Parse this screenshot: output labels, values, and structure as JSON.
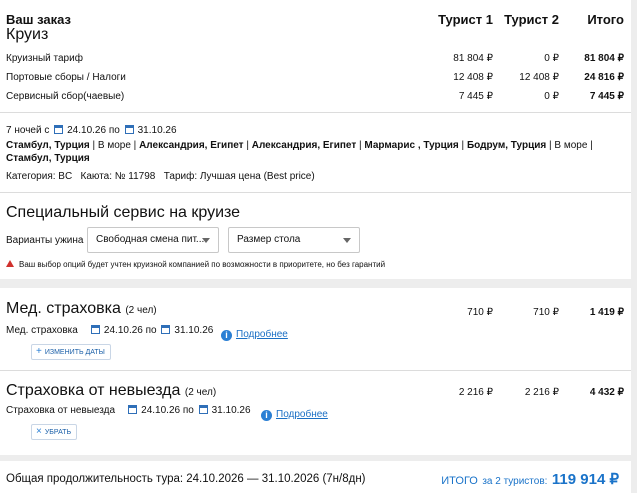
{
  "order": {
    "title": "Ваш заказ",
    "subtitle": "Круиз",
    "col_t1": "Турист 1",
    "col_t2": "Турист 2",
    "col_total": "Итого",
    "rows": [
      {
        "label": "Круизный тариф",
        "t1": "81 804 ₽",
        "t2": "0 ₽",
        "total": "81 804 ₽"
      },
      {
        "label": "Портовые сборы / Налоги",
        "t1": "12 408 ₽",
        "t2": "12 408 ₽",
        "total": "24 816 ₽"
      },
      {
        "label": "Сервисный сбор(чаевые)",
        "t1": "7 445 ₽",
        "t2": "0 ₽",
        "total": "7 445 ₽"
      }
    ]
  },
  "cruise": {
    "nights": "7 ночей с",
    "date_from": "24.10.26",
    "date_sep": "по",
    "date_to": "31.10.26",
    "route": [
      {
        "text": "Стамбул, Турция",
        "bold": true
      },
      {
        "text": " | В море | ",
        "bold": false
      },
      {
        "text": "Александрия, Египет",
        "bold": true
      },
      {
        "text": " | ",
        "bold": false
      },
      {
        "text": "Александрия, Египет",
        "bold": true
      },
      {
        "text": " | ",
        "bold": false
      },
      {
        "text": "Мармарис , Турция",
        "bold": true
      },
      {
        "text": " | ",
        "bold": false
      },
      {
        "text": "Бодрум, Турция",
        "bold": true
      },
      {
        "text": " | В море | ",
        "bold": false
      },
      {
        "text": "Стамбул, Турция",
        "bold": true
      }
    ],
    "category": "Категория: BC",
    "cabin": "Каюта: № 11798",
    "tariff": "Тариф: Лучшая цена (Best price)"
  },
  "special": {
    "title": "Специальный сервис на круизе",
    "dinner_label": "Варианты ужина",
    "dinner_value": "Свободная смена пит...",
    "table_value": "Размер стола",
    "warning": "Ваш выбор опций будет учтен круизной компанией по возможности в приоритете, но без гарантий"
  },
  "med": {
    "title": "Мед. страховка",
    "count": "(2 чел)",
    "t1": "710 ₽",
    "t2": "710 ₽",
    "total": "1 419 ₽",
    "label": "Мед. страховка",
    "date_from": "24.10.26",
    "date_sep": "по",
    "date_to": "31.10.26",
    "more": "Подробнее",
    "button": "ИЗМЕНИТЬ ДАТЫ"
  },
  "cancel": {
    "title": "Страховка от невыезда",
    "count": "(2 чел)",
    "t1": "2 216 ₽",
    "t2": "2 216 ₽",
    "total": "4 432 ₽",
    "label": "Страховка от невыезда",
    "date_from": "24.10.26",
    "date_sep": "по",
    "date_to": "31.10.26",
    "more": "Подробнее",
    "button": "УБРАТЬ"
  },
  "footer": {
    "duration": "Общая продолжительность тура: 24.10.2026 — 31.10.2026 (7н/8дн)",
    "total_label": "ИТОГО",
    "total_for": "за 2 туристов:",
    "total_value": "119 914 ₽"
  },
  "colors": {
    "accent": "#1a73c9",
    "warning": "#d0312d"
  }
}
